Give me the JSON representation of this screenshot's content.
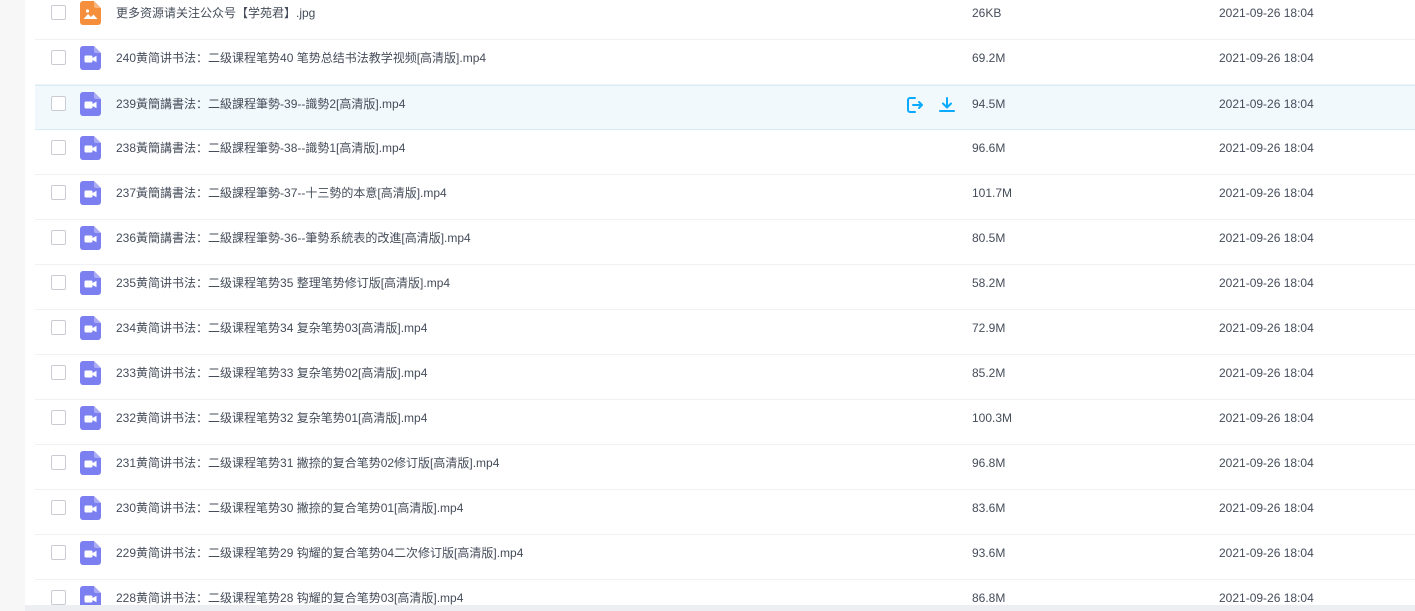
{
  "files": [
    {
      "type": "image",
      "icon": "image-file-icon",
      "name": "更多资源请关注公众号【学苑君】.jpg",
      "size": "26KB",
      "date": "2021-09-26 18:04"
    },
    {
      "type": "video",
      "icon": "video-file-icon",
      "name": "240黄简讲书法：二级课程笔势40 笔势总结书法教学视频[高清版].mp4",
      "size": "69.2M",
      "date": "2021-09-26 18:04"
    },
    {
      "type": "video",
      "icon": "video-file-icon",
      "name": "239黃簡講書法：二級課程筆勢-39--識勢2[高清版].mp4",
      "size": "94.5M",
      "date": "2021-09-26 18:04",
      "hover": true
    },
    {
      "type": "video",
      "icon": "video-file-icon",
      "name": "238黃簡講書法：二級課程筆勢-38--識勢1[高清版].mp4",
      "size": "96.6M",
      "date": "2021-09-26 18:04"
    },
    {
      "type": "video",
      "icon": "video-file-icon",
      "name": "237黃簡講書法：二級課程筆勢-37--十三勢的本意[高清版].mp4",
      "size": "101.7M",
      "date": "2021-09-26 18:04"
    },
    {
      "type": "video",
      "icon": "video-file-icon",
      "name": "236黃簡講書法：二級課程筆勢-36--筆勢系統表的改進[高清版].mp4",
      "size": "80.5M",
      "date": "2021-09-26 18:04"
    },
    {
      "type": "video",
      "icon": "video-file-icon",
      "name": "235黄简讲书法：二级课程笔势35 整理笔势修订版[高清版].mp4",
      "size": "58.2M",
      "date": "2021-09-26 18:04"
    },
    {
      "type": "video",
      "icon": "video-file-icon",
      "name": "234黄简讲书法：二级课程笔势34 复杂笔势03[高清版].mp4",
      "size": "72.9M",
      "date": "2021-09-26 18:04"
    },
    {
      "type": "video",
      "icon": "video-file-icon",
      "name": "233黄简讲书法：二级课程笔势33 复杂笔势02[高清版].mp4",
      "size": "85.2M",
      "date": "2021-09-26 18:04"
    },
    {
      "type": "video",
      "icon": "video-file-icon",
      "name": "232黄简讲书法：二级课程笔势32 复杂笔势01[高清版].mp4",
      "size": "100.3M",
      "date": "2021-09-26 18:04"
    },
    {
      "type": "video",
      "icon": "video-file-icon",
      "name": "231黄简讲书法：二级课程笔势31 撇捺的复合笔势02修订版[高清版].mp4",
      "size": "96.8M",
      "date": "2021-09-26 18:04"
    },
    {
      "type": "video",
      "icon": "video-file-icon",
      "name": "230黄简讲书法：二级课程笔势30 撇捺的复合笔势01[高清版].mp4",
      "size": "83.6M",
      "date": "2021-09-26 18:04"
    },
    {
      "type": "video",
      "icon": "video-file-icon",
      "name": "229黄简讲书法：二级课程笔势29 钩耀的复合笔势04二次修订版[高清版].mp4",
      "size": "93.6M",
      "date": "2021-09-26 18:04"
    },
    {
      "type": "video",
      "icon": "video-file-icon",
      "name": "228黄简讲书法：二级课程笔势28 钩耀的复合笔势03[高清版].mp4",
      "size": "86.8M",
      "date": "2021-09-26 18:04"
    }
  ],
  "hover_actions": {
    "move_icon": "move-out-icon",
    "download_icon": "download-icon"
  },
  "colors": {
    "video_icon": "#7b7ff0",
    "image_icon": "#f58f3c",
    "action_icon": "#09aaff",
    "hover_row": "#f1f9fc"
  }
}
